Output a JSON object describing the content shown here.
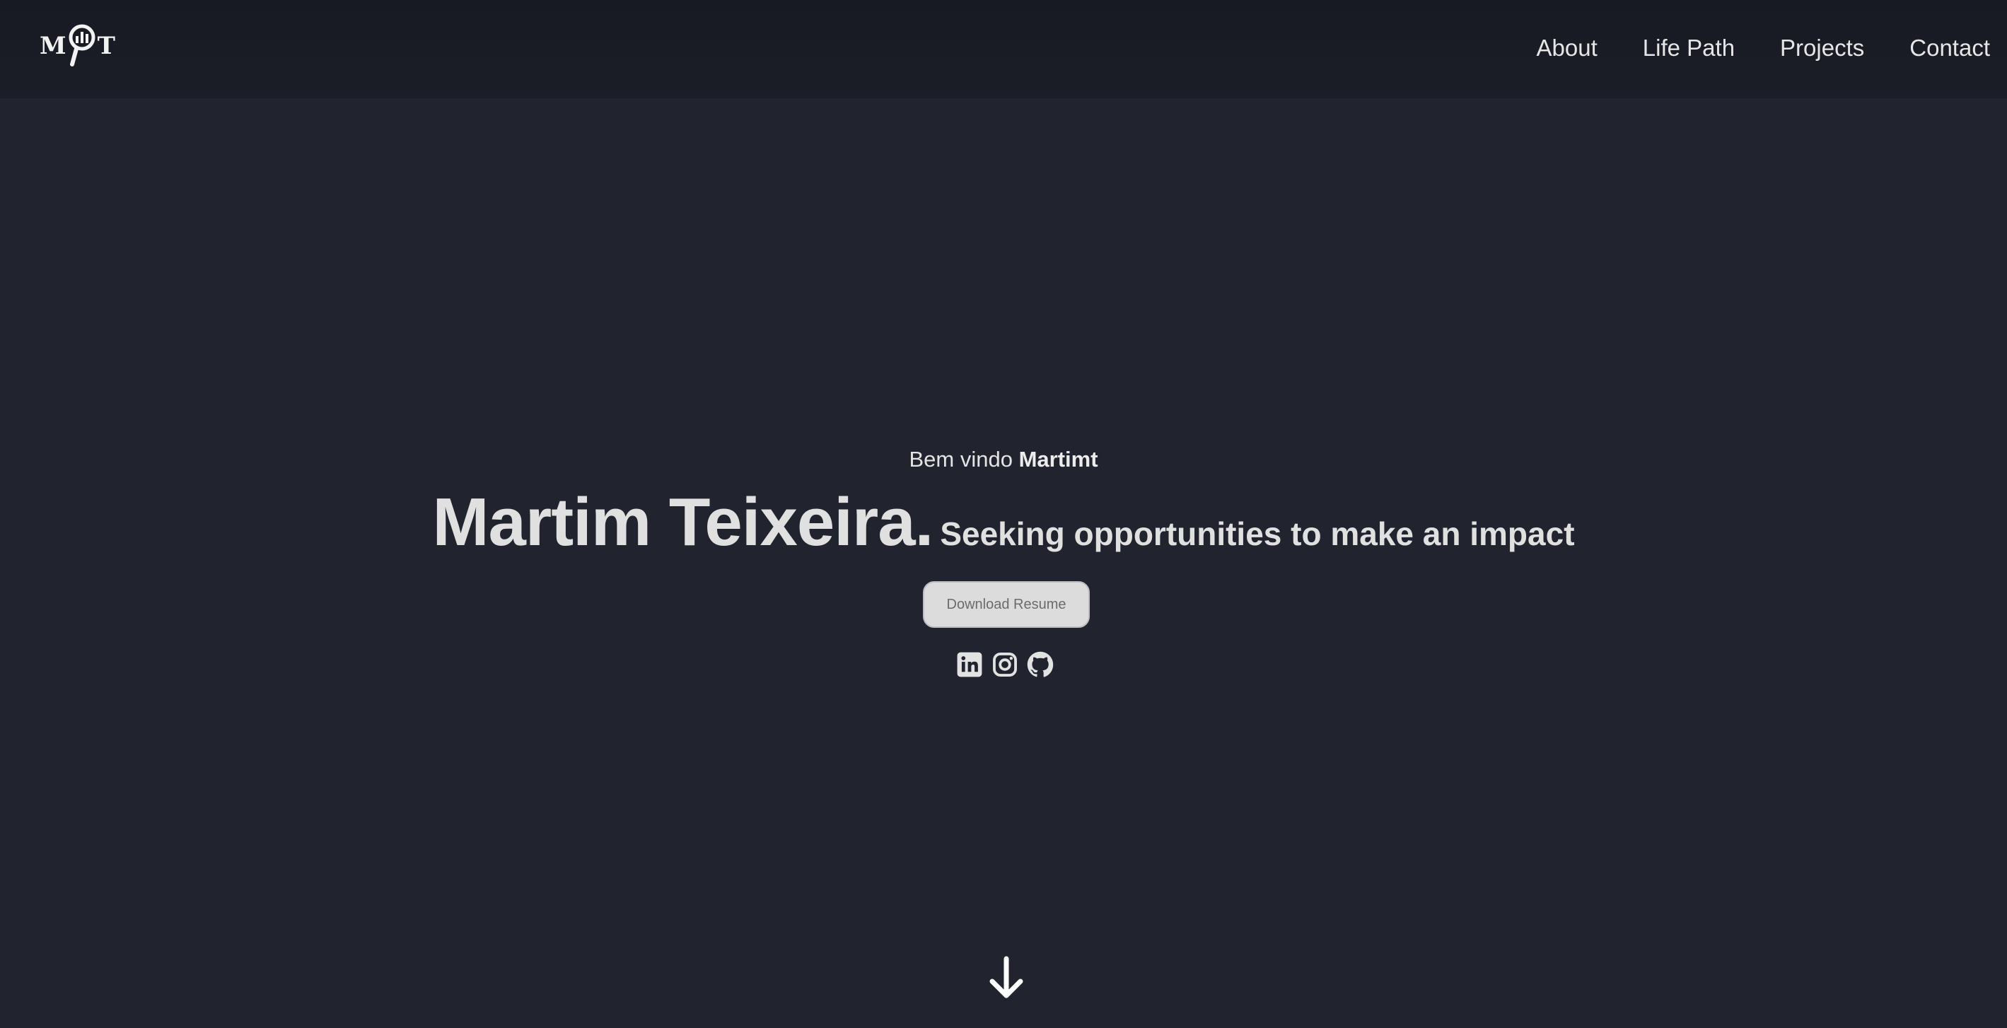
{
  "brand": {
    "logo_left": "M",
    "logo_right": "T",
    "logo_icon": "magnifier-chart-icon"
  },
  "nav": {
    "items": [
      {
        "label": "About"
      },
      {
        "label": "Life Path"
      },
      {
        "label": "Projects"
      },
      {
        "label": "Contact"
      }
    ]
  },
  "hero": {
    "greeting": "Bem vindo",
    "username": "Martimt",
    "name": "Martim Teixeira.",
    "tagline": "Seeking opportunities to make an impact",
    "resume_button": "Download Resume",
    "socials": [
      {
        "icon": "linkedin-icon"
      },
      {
        "icon": "instagram-icon"
      },
      {
        "icon": "github-icon"
      }
    ],
    "scroll_icon": "arrow-down-icon"
  },
  "colors": {
    "background": "#21232f",
    "navbar": "#1a1c25",
    "text": "#dedede",
    "button_bg": "#dcdcdc",
    "button_text": "#6b6b6b"
  }
}
